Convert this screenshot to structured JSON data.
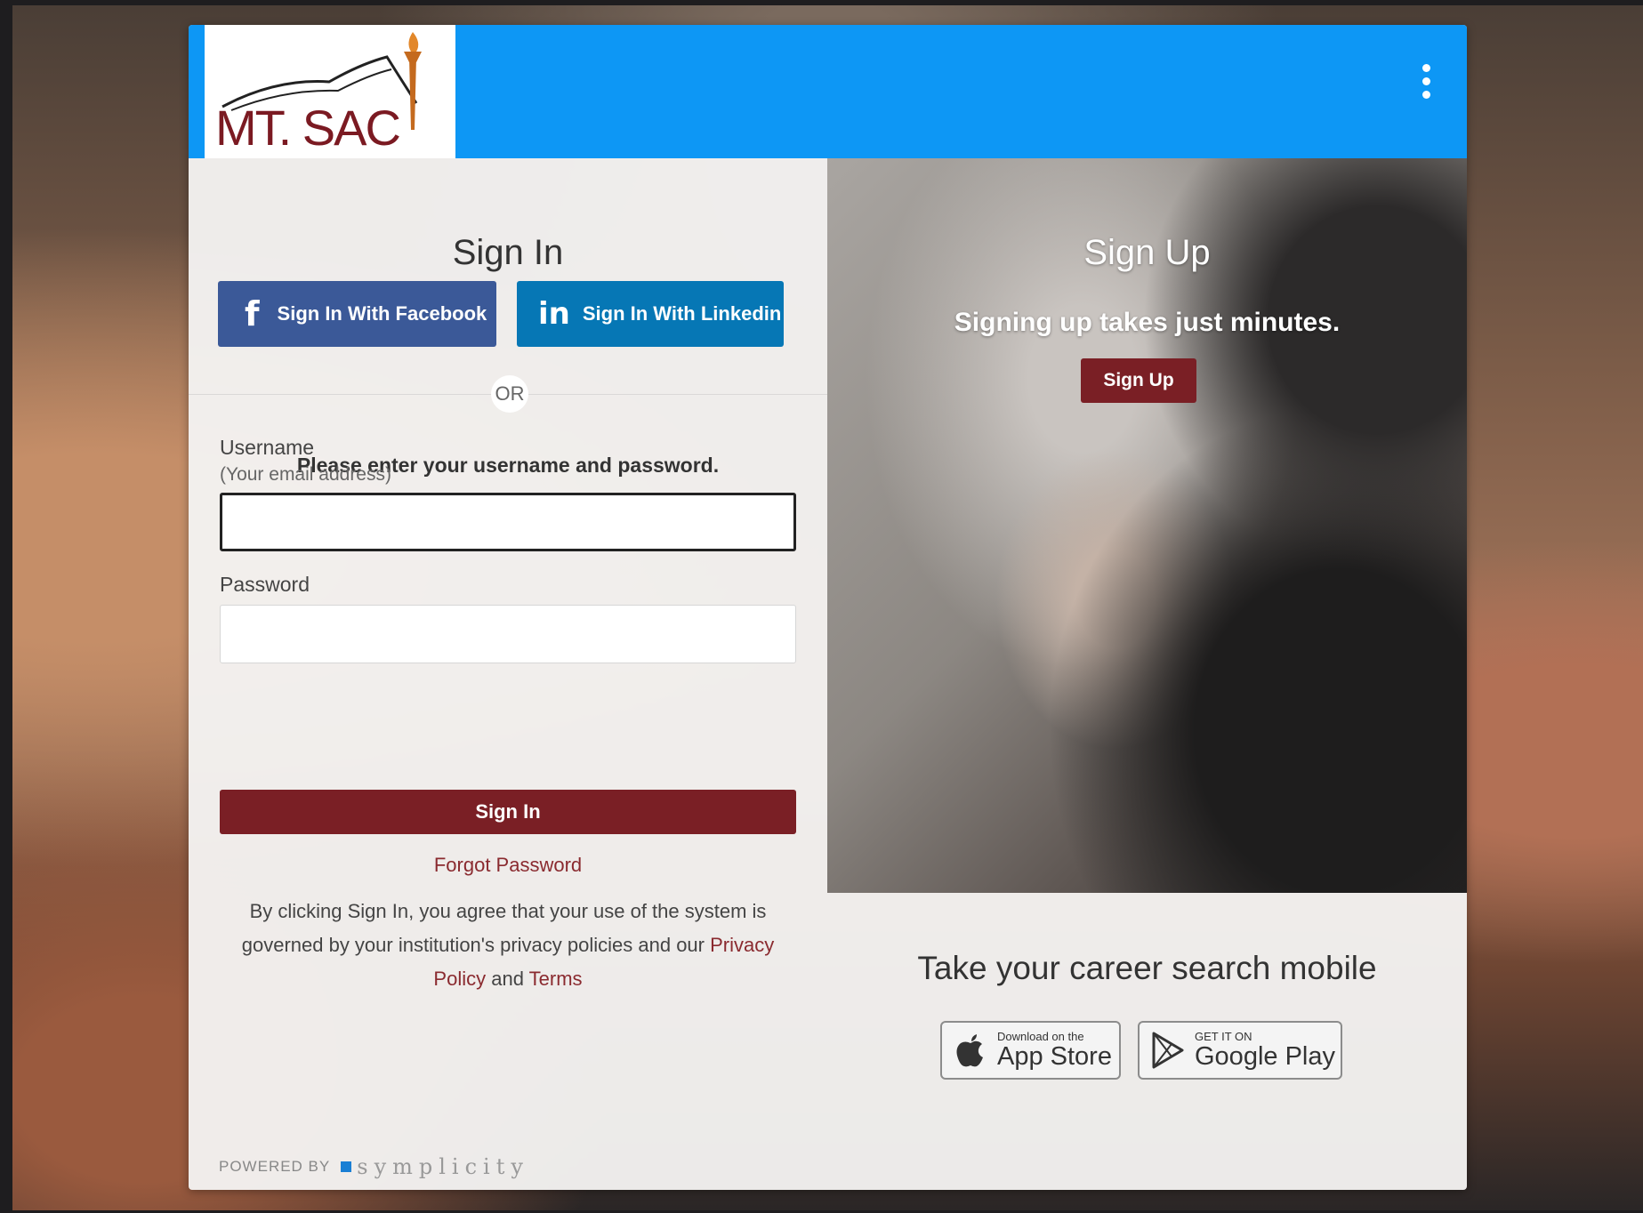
{
  "logo": {
    "text": "MT. SAC"
  },
  "topbar": {
    "menu_icon": "kebab-menu-icon",
    "brand_color": "#0d97f5"
  },
  "signin": {
    "title": "Sign In",
    "facebook_label": "Sign In With Facebook",
    "linkedin_label": "Sign In With Linkedin",
    "or_label": "OR",
    "instructions": "Please enter your username and password.",
    "username_label": "Username",
    "username_hint": "(Your email address)",
    "username_value": "",
    "password_label": "Password",
    "password_value": "",
    "submit_label": "Sign In",
    "forgot_label": "Forgot Password",
    "legal_text": "By clicking Sign In, you agree that your use of the system is governed by your institution's privacy policies and our",
    "privacy_label": "Privacy Policy",
    "and_label": "and",
    "terms_label": "Terms",
    "accent_color": "#7a1f25"
  },
  "signup": {
    "title": "Sign Up",
    "subtitle": "Signing up takes just minutes.",
    "button_label": "Sign Up"
  },
  "mobile": {
    "title": "Take your career search mobile",
    "appstore_small": "Download on the",
    "appstore_big": "App Store",
    "googleplay_small": "GET IT ON",
    "googleplay_big": "Google Play"
  },
  "footer": {
    "powered_by": "POWERED BY",
    "brand": "symplicity"
  }
}
